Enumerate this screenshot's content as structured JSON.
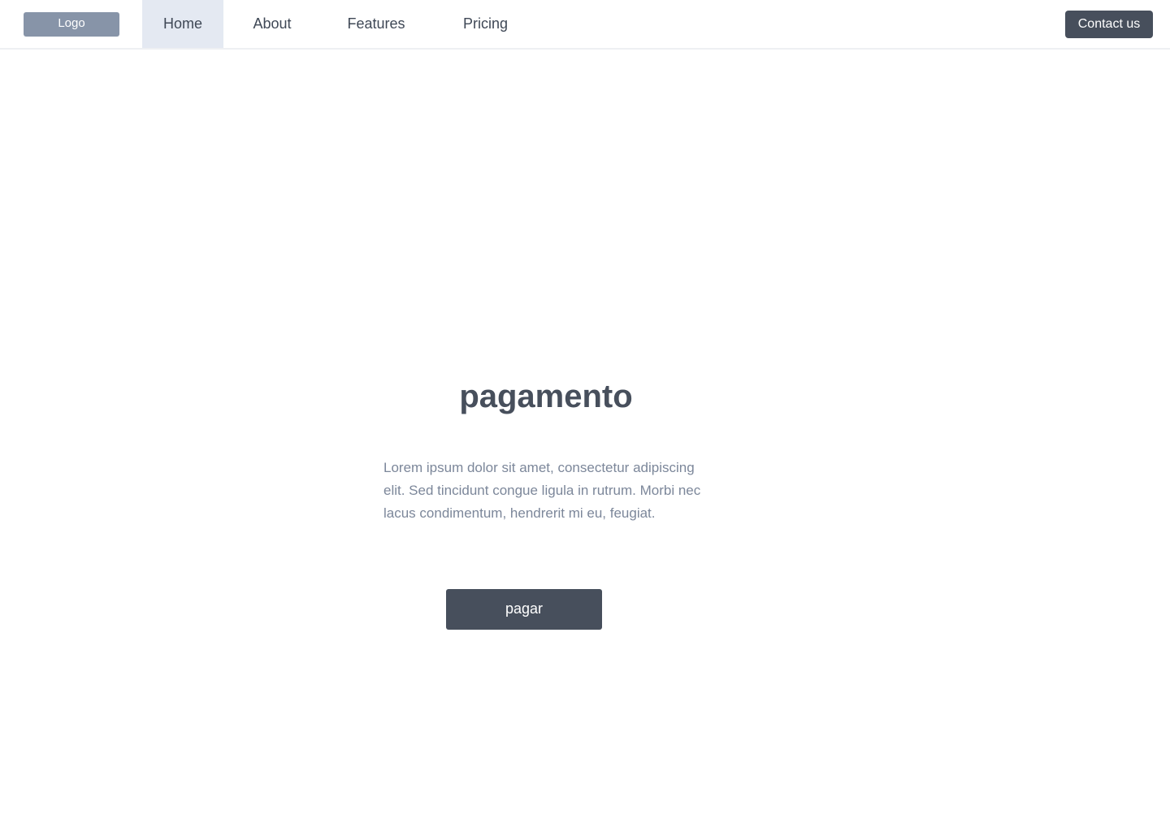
{
  "navbar": {
    "logo_label": "Logo",
    "items": [
      {
        "label": "Home",
        "active": true
      },
      {
        "label": "About",
        "active": false
      },
      {
        "label": "Features",
        "active": false
      },
      {
        "label": "Pricing",
        "active": false
      }
    ],
    "contact_label": "Contact us"
  },
  "hero": {
    "title": "pagamento",
    "body": "Lorem ipsum dolor sit amet, consectetur adipiscing elit. Sed tincidunt congue ligula in rutrum. Morbi nec lacus condimentum, hendrerit mi eu, feugiat.",
    "button_label": "pagar"
  },
  "colors": {
    "primary": "#474f5c",
    "logo_bg": "#8794a8",
    "active_nav_bg": "#e4e9f2",
    "body_text": "#7c879a"
  }
}
